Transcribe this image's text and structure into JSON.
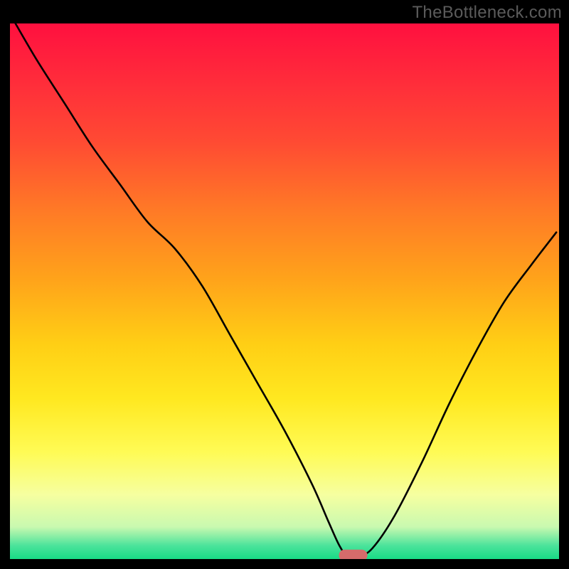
{
  "watermark": "TheBottleneck.com",
  "chart_data": {
    "type": "line",
    "title": "",
    "xlabel": "",
    "ylabel": "",
    "xlim": [
      0,
      100
    ],
    "ylim": [
      0,
      100
    ],
    "gradient_stops": [
      {
        "offset": 0.0,
        "color": "#ff103f"
      },
      {
        "offset": 0.1,
        "color": "#ff2a3b"
      },
      {
        "offset": 0.22,
        "color": "#ff4a33"
      },
      {
        "offset": 0.35,
        "color": "#ff7a26"
      },
      {
        "offset": 0.48,
        "color": "#ffa41a"
      },
      {
        "offset": 0.6,
        "color": "#ffcf15"
      },
      {
        "offset": 0.7,
        "color": "#ffe820"
      },
      {
        "offset": 0.8,
        "color": "#fffb55"
      },
      {
        "offset": 0.88,
        "color": "#f6ffa0"
      },
      {
        "offset": 0.94,
        "color": "#c9f9b0"
      },
      {
        "offset": 0.975,
        "color": "#4be39b"
      },
      {
        "offset": 1.0,
        "color": "#18db86"
      }
    ],
    "series": [
      {
        "name": "bottleneck-curve",
        "x": [
          1,
          5,
          10,
          15,
          20,
          25,
          30,
          35,
          40,
          45,
          50,
          55,
          58,
          60,
          61.5,
          63.5,
          66,
          70,
          75,
          80,
          85,
          90,
          95,
          99.5
        ],
        "y": [
          100,
          93,
          85,
          77,
          70,
          63,
          58,
          51,
          42,
          33,
          24,
          14,
          7,
          2.5,
          0.5,
          0.5,
          2,
          8,
          18,
          29,
          39,
          48,
          55,
          61
        ]
      }
    ],
    "marker": {
      "x_center": 62.5,
      "x_halfwidth": 2.6,
      "y": 0.7,
      "color": "#d66b6b"
    }
  }
}
